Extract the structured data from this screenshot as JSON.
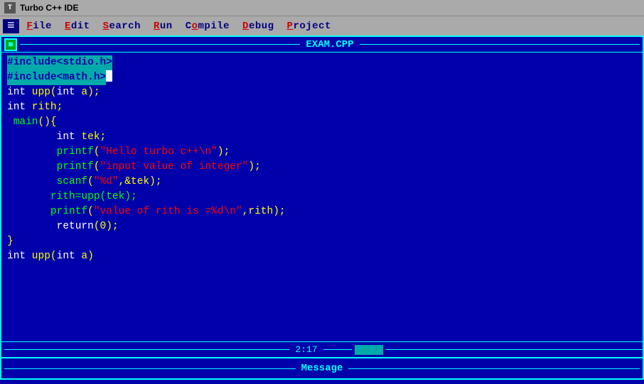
{
  "titlebar": {
    "icon_label": "T",
    "title": "Turbo C++ IDE"
  },
  "menubar": {
    "items": [
      {
        "label": "≡",
        "is_icon": true
      },
      {
        "prefix": "",
        "hotkey": "F",
        "suffix": "ile",
        "full": "File"
      },
      {
        "prefix": "",
        "hotkey": "E",
        "suffix": "dit",
        "full": "Edit"
      },
      {
        "prefix": "",
        "hotkey": "S",
        "suffix": "earch",
        "full": "Search"
      },
      {
        "prefix": "",
        "hotkey": "R",
        "suffix": "un",
        "full": "Run"
      },
      {
        "prefix": "C",
        "hotkey": "o",
        "suffix": "mpile",
        "full": "Compile"
      },
      {
        "prefix": "",
        "hotkey": "D",
        "suffix": "ebug",
        "full": "Debug"
      },
      {
        "prefix": "",
        "hotkey": "P",
        "suffix": "roject",
        "full": "Project"
      }
    ]
  },
  "editor": {
    "filename": "EXAM.CPP",
    "status_pos": "2:17",
    "message_label": "Message",
    "code_lines": [
      {
        "text": "#include<stdio.h>",
        "style": "highlight"
      },
      {
        "text": "#include<math.h>_",
        "style": "highlight"
      },
      {
        "parts": [
          {
            "t": "int",
            "s": "white"
          },
          {
            "t": " upp(",
            "s": "yellow"
          },
          {
            "t": "int",
            "s": "white"
          },
          {
            "t": " a);",
            "s": "yellow"
          }
        ]
      },
      {
        "parts": [
          {
            "t": "int",
            "s": "white"
          },
          {
            "t": " rith;",
            "s": "yellow"
          }
        ]
      },
      {
        "parts": [
          {
            "t": " ",
            "s": "yellow"
          },
          {
            "t": "main",
            "s": "green"
          },
          {
            "t": "(){",
            "s": "yellow"
          }
        ]
      },
      {
        "parts": [
          {
            "t": "        int",
            "s": "white"
          },
          {
            "t": " tek;",
            "s": "yellow"
          }
        ]
      },
      {
        "parts": [
          {
            "t": "        ",
            "s": "yellow"
          },
          {
            "t": "printf",
            "s": "green"
          },
          {
            "t": "(",
            "s": "yellow"
          },
          {
            "t": "\"Hello turbo c++\\n\"",
            "s": "red"
          },
          {
            "t": ");",
            "s": "yellow"
          }
        ]
      },
      {
        "parts": [
          {
            "t": "        ",
            "s": "yellow"
          },
          {
            "t": "printf",
            "s": "green"
          },
          {
            "t": "(",
            "s": "yellow"
          },
          {
            "t": "\"input value of integer\"",
            "s": "red"
          },
          {
            "t": ");",
            "s": "yellow"
          }
        ]
      },
      {
        "parts": [
          {
            "t": "        ",
            "s": "yellow"
          },
          {
            "t": "scanf",
            "s": "green"
          },
          {
            "t": "(",
            "s": "yellow"
          },
          {
            "t": "\"%d\"",
            "s": "red"
          },
          {
            "t": ",&tek);",
            "s": "yellow"
          }
        ]
      },
      {
        "parts": [
          {
            "t": "       ",
            "s": "yellow"
          },
          {
            "t": "rith=upp(tek);",
            "s": "green"
          }
        ]
      },
      {
        "parts": [
          {
            "t": "       ",
            "s": "yellow"
          },
          {
            "t": "printf",
            "s": "green"
          },
          {
            "t": "(",
            "s": "yellow"
          },
          {
            "t": "\"value of rith is =%d\\n\"",
            "s": "red"
          },
          {
            "t": ",rith);",
            "s": "yellow"
          }
        ]
      },
      {
        "parts": [
          {
            "t": "        ",
            "s": "yellow"
          },
          {
            "t": "return",
            "s": "white"
          },
          {
            "t": "(0);",
            "s": "yellow"
          }
        ]
      },
      {
        "parts": [
          {
            "t": "}",
            "s": "yellow"
          }
        ]
      },
      {
        "parts": [
          {
            "t": "int",
            "s": "white"
          },
          {
            "t": " upp(",
            "s": "yellow"
          },
          {
            "t": "int",
            "s": "white"
          },
          {
            "t": " a)",
            "s": "yellow"
          }
        ]
      }
    ]
  }
}
